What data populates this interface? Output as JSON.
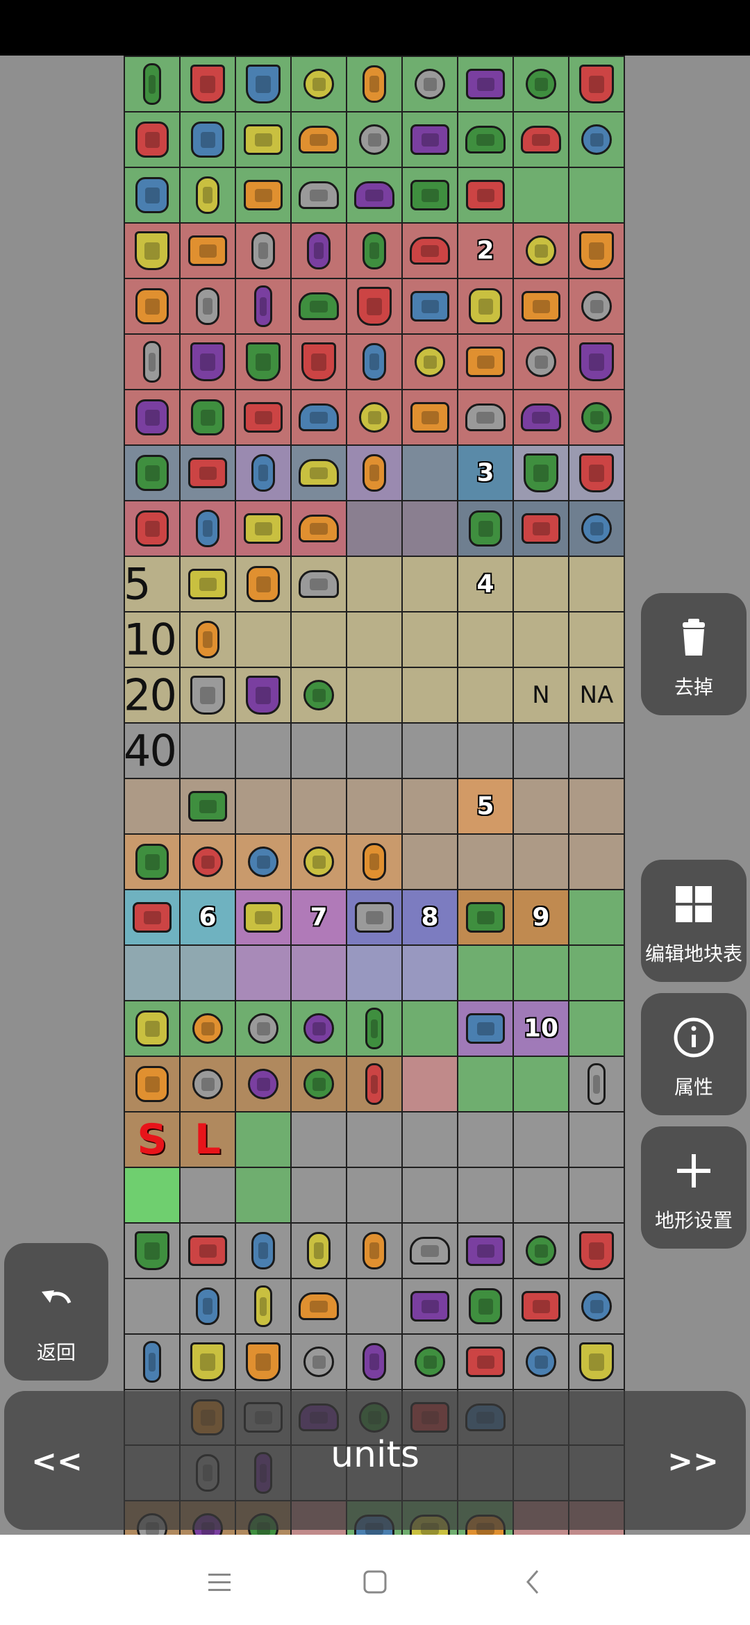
{
  "page_title": "units",
  "nav": {
    "prev_label": "<<",
    "next_label": ">>"
  },
  "buttons": {
    "remove": {
      "label": "去掉",
      "icon": "trash-icon"
    },
    "edit_tileset": {
      "label": "编辑地块表",
      "icon": "grid-icon"
    },
    "properties": {
      "label": "属性",
      "icon": "info-icon"
    },
    "terrain_settings": {
      "label": "地形设置",
      "icon": "plus-icon"
    },
    "back": {
      "label": "返回",
      "icon": "undo-icon"
    }
  },
  "system_nav": {
    "menu_icon": "menu-icon",
    "home_icon": "home-icon",
    "back_icon": "back-arrow-icon"
  },
  "tile_grid": {
    "rows": [
      {
        "bg": "#6fae6f",
        "cells": [
          "s6",
          "s5",
          "s5",
          "s4",
          "s2",
          "s4",
          "s3",
          "s4",
          "s5"
        ]
      },
      {
        "bg": "#6fae6f",
        "cells": [
          "s1",
          "s1",
          "s3",
          "s7",
          "s4",
          "s3",
          "s7",
          "s7",
          "s4"
        ]
      },
      {
        "bg": "#6fae6f",
        "cells": [
          "s1",
          "s2",
          "s3",
          "s7",
          "s7",
          "s3",
          "s3",
          "",
          ""
        ]
      },
      {
        "bg": "#c07272",
        "cells": [
          "s5",
          "s3",
          "s2",
          "s2",
          "s2",
          "s7",
          {
            "label": "2"
          },
          "s4",
          "s5"
        ]
      },
      {
        "bg": "#c07272",
        "cells": [
          "s1",
          "s2",
          "s6",
          "s7",
          "s5",
          "s3",
          "s1",
          "s3",
          "s4"
        ]
      },
      {
        "bg": "#c07272",
        "cells": [
          "s6",
          "s5",
          "s5",
          "s5",
          "s2",
          "s4",
          "s3",
          "s4",
          "s5"
        ]
      },
      {
        "bg": "#c07272",
        "cells": [
          "s1",
          "s1",
          "s3",
          "s7",
          "s4",
          "s3",
          "s7",
          "s7",
          "s4"
        ]
      },
      {
        "bg": "#7b8a9a",
        "cells": [
          "s1",
          "s3",
          "s2",
          "s7",
          "s2",
          "",
          "",
          "s5",
          "s5"
        ],
        "override": [
          null,
          null,
          null,
          null,
          null,
          null,
          {
            "label": "3",
            "bg": "#5a8aa8"
          },
          null,
          null
        ]
      },
      {
        "bg": "#bf6f78",
        "cells": [
          "s1",
          "s2",
          "s3",
          "s7",
          "",
          "",
          "s1",
          "s3",
          "s4"
        ],
        "tail_bg": "#6f7f90"
      },
      {
        "bg": "#b9b089",
        "cells": [
          {
            "label": "5",
            "style": "big"
          },
          "s3",
          "s1",
          "s7",
          "",
          "",
          {
            "label": "4"
          },
          "",
          ""
        ]
      },
      {
        "bg": "#b9b089",
        "cells": [
          {
            "label": "10",
            "style": "big"
          },
          "s2",
          "",
          "",
          "",
          "",
          "",
          "",
          ""
        ]
      },
      {
        "bg": "#b9b089",
        "cells": [
          {
            "label": "20",
            "style": "big"
          },
          "s5",
          "s5",
          "s4",
          "",
          "",
          "",
          {
            "label": "N",
            "style": "plain"
          },
          {
            "label": "NA",
            "style": "plain"
          }
        ]
      },
      {
        "bg": "#959595",
        "cells": [
          {
            "label": "40",
            "style": "big"
          },
          "",
          "",
          "",
          "",
          "",
          "",
          "",
          ""
        ]
      },
      {
        "bg": "#ad9a86",
        "cells": [
          "",
          "s3",
          "",
          "",
          "",
          "",
          {
            "label": "5"
          },
          "",
          ""
        ]
      },
      {
        "bg": "#c99a6c",
        "cells": [
          "s1",
          "s4",
          "s4",
          "s4",
          "s2",
          "",
          "",
          "",
          ""
        ]
      },
      {
        "bg": "#7aa8b0",
        "cells": [
          "s3",
          {
            "label": "6"
          },
          "s3",
          {
            "label": "7"
          },
          "s3",
          {
            "label": "8"
          },
          "s3",
          {
            "label": "9"
          },
          ""
        ]
      },
      {
        "bg": "#8fa4ab",
        "cells": [
          "",
          "",
          "",
          "",
          "",
          "",
          "",
          "",
          ""
        ]
      },
      {
        "bg": "#6fae6f",
        "cells": [
          "s1",
          "s4",
          "s4",
          "s4",
          "s6",
          "",
          "s3",
          {
            "label": "10"
          },
          ""
        ]
      },
      {
        "bg": "#b0895e",
        "cells": [
          "s1",
          "s4",
          "s4",
          "s4",
          "s6",
          "",
          "",
          "",
          "s6"
        ]
      },
      {
        "bg": "#959595",
        "cells": [
          {
            "label": "S",
            "style": "red"
          },
          {
            "label": "L",
            "style": "red"
          },
          "",
          "",
          "",
          "",
          "",
          "",
          ""
        ]
      },
      {
        "bg": "#959595",
        "cells": [
          "",
          "",
          "",
          "",
          "",
          "",
          "",
          "",
          ""
        ]
      },
      {
        "bg": "#959595",
        "cells": [
          "s5",
          "s3",
          "s2",
          "s2",
          "s2",
          "s7",
          "s3",
          "s4",
          "s5"
        ]
      },
      {
        "bg": "#959595",
        "cells": [
          "",
          "s2",
          "s6",
          "s7",
          "",
          "s3",
          "s1",
          "s3",
          "s4"
        ]
      },
      {
        "bg": "#959595",
        "cells": [
          "s6",
          "s5",
          "s5",
          "s4",
          "s2",
          "s4",
          "s3",
          "s4",
          "s5"
        ]
      },
      {
        "bg": "#959595",
        "cells": [
          "",
          "s1",
          "s3",
          "s7",
          "s4",
          "s3",
          "s7",
          "",
          ""
        ]
      },
      {
        "bg": "#959595",
        "cells": [
          "",
          "s2",
          "s6",
          "",
          "",
          "",
          "",
          "",
          ""
        ]
      },
      {
        "bg": "#b0895e",
        "cells": [
          "s4",
          "s4",
          "s4",
          "",
          "s7",
          "s7",
          "s7",
          "",
          ""
        ]
      }
    ],
    "row_colors": {
      "1": [
        "#6fae6f",
        "#6fae6f",
        "#6fae6f",
        "#6fae6f",
        "#6fae6f",
        "#6fae6f",
        "#6fae6f",
        "#6fae6f",
        "#6fae6f"
      ],
      "7": [
        "#7b8a9a",
        "#7b8a9a",
        "#9a8ab0",
        "#7b8a9a",
        "#9a8ab0",
        "#7b8a9a",
        "#5a8aa8",
        "#9a9ab0",
        "#9a9ab0"
      ],
      "8": [
        "#bf6f78",
        "#bf6f78",
        "#bf6f78",
        "#bf6f78",
        "#8a7f90",
        "#8a7f90",
        "#6f7f90",
        "#6f7f90",
        "#6f7f90"
      ],
      "13": [
        "#ad9a86",
        "#ad9a86",
        "#ad9a86",
        "#ad9a86",
        "#ad9a86",
        "#ad9a86",
        "#d29a66",
        "#ad9a86",
        "#ad9a86"
      ],
      "14": [
        "#c99a6c",
        "#c99a6c",
        "#c99a6c",
        "#c99a6c",
        "#c99a6c",
        "#ad9a86",
        "#ad9a86",
        "#ad9a86",
        "#ad9a86"
      ],
      "15": [
        "#6fb2c0",
        "#6fb2c0",
        "#b07ab8",
        "#b07ab8",
        "#7c7cc0",
        "#7c7cc0",
        "#c08a50",
        "#c08a50",
        "#6fae6f"
      ],
      "16": [
        "#8fa8b0",
        "#8fa8b0",
        "#a88ab8",
        "#a88ab8",
        "#9898c0",
        "#9898c0",
        "#6fae6f",
        "#6fae6f",
        "#6fae6f"
      ],
      "17": [
        "#6fae6f",
        "#6fae6f",
        "#6fae6f",
        "#6fae6f",
        "#6fae6f",
        "#6fae6f",
        "#a07ab8",
        "#a07ab8",
        "#6fae6f"
      ],
      "18": [
        "#b0895e",
        "#b0895e",
        "#b0895e",
        "#b0895e",
        "#b0895e",
        "#c08a8a",
        "#6fae6f",
        "#6fae6f",
        "#959595"
      ],
      "19": [
        "#b0895e",
        "#b0895e",
        "#6fae6f",
        "#959595",
        "#959595",
        "#959595",
        "#959595",
        "#959595",
        "#959595"
      ],
      "20": [
        "#6fcf6f",
        "#959595",
        "#6fae6f",
        "#959595",
        "#959595",
        "#959595",
        "#959595",
        "#959595",
        "#959595"
      ],
      "26": [
        "#b0895e",
        "#b0895e",
        "#b0895e",
        "#c08a8a",
        "#6fae6f",
        "#6fae6f",
        "#6fae6f",
        "#c08a8a",
        "#c08a8a"
      ]
    },
    "sprite_colors": [
      "#3f8f3f",
      "#cc4444",
      "#4a7fb0",
      "#c9c040",
      "#e09030",
      "#9a9a9a",
      "#7a3fa0"
    ]
  }
}
